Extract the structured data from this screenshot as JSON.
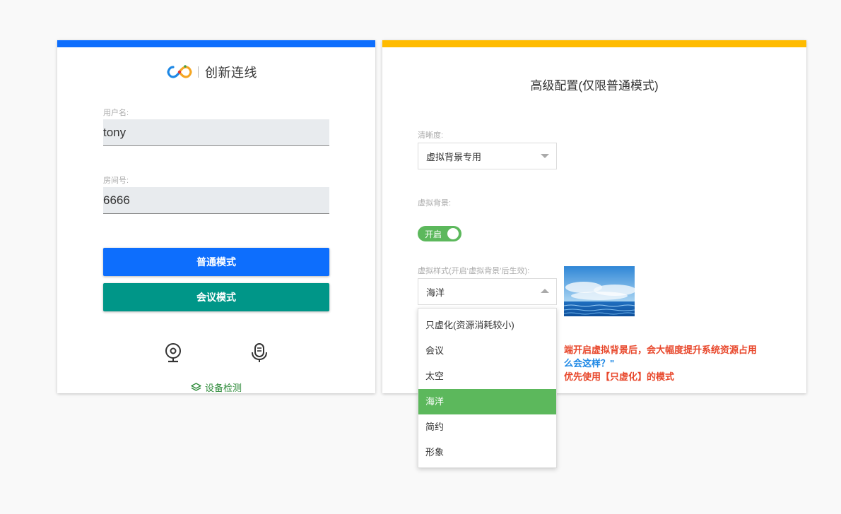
{
  "login": {
    "brand_name": "创新连线",
    "username_label": "用户名:",
    "username_value": "tony",
    "room_label": "房间号:",
    "room_value": "6666",
    "normal_mode_button": "普通模式",
    "meeting_mode_button": "会议模式",
    "device_check": "设备检测",
    "icons": [
      "camera-icon",
      "microphone-icon",
      "layers-icon"
    ]
  },
  "advanced": {
    "title": "高级配置(仅限普通模式)",
    "clarity_label": "清晰度:",
    "clarity_value": "虚拟背景专用",
    "virtual_bg_label": "虚拟背景:",
    "virtual_bg_toggle": "开启",
    "style_label": "虚拟样式(开启‘虚拟背景’后生效):",
    "style_value": "海洋",
    "notice_line1": "端开启虚拟背景后，会大幅度提升系统资源占用",
    "notice_line2": "么会这样？\"",
    "notice_line3": "优先使用【只虚化】的模式",
    "style_options": [
      "只虚化(资源消耗较小)",
      "会议",
      "太空",
      "海洋",
      "简约",
      "形象"
    ],
    "selected_option": "海洋"
  },
  "colors": {
    "primary_blue": "#0d6efd",
    "meeting_green": "#009688",
    "accent_yellow": "#ffbb00",
    "toggle_green": "#5cb85c",
    "notice_red": "#e8472b",
    "notice_blue": "#1e88e5"
  }
}
